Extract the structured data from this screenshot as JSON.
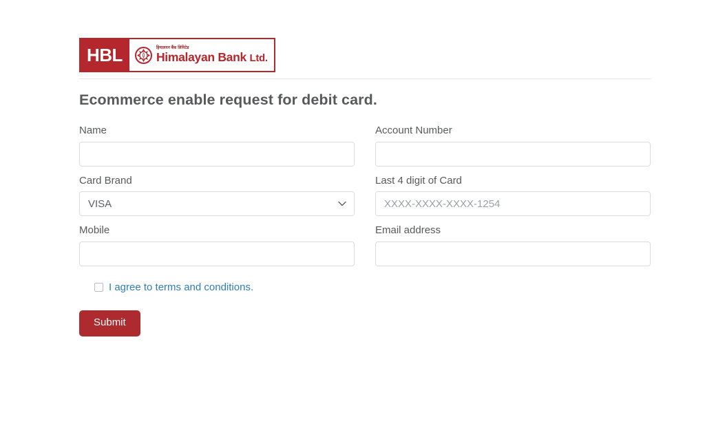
{
  "brand": {
    "mark_text": "HBL",
    "native_name": "हिमालयन बैंक लिमिटेड",
    "name": "Himalayan Bank",
    "suffix": "Ltd.",
    "primary_color": "#b3272d",
    "logo_icon": "himalayan-bank-emblem-icon"
  },
  "heading": {
    "title": "Ecommerce enable request for debit card."
  },
  "form": {
    "name": {
      "label": "Name",
      "value": "",
      "placeholder": ""
    },
    "account_number": {
      "label": "Account Number",
      "value": "",
      "placeholder": ""
    },
    "card_brand": {
      "label": "Card Brand",
      "selected": "VISA",
      "options": [
        "VISA"
      ],
      "chevron_icon": "chevron-down-icon"
    },
    "last_four": {
      "label": "Last 4 digit of Card",
      "value": "",
      "placeholder": "XXXX-XXXX-XXXX-1254"
    },
    "mobile": {
      "label": "Mobile",
      "value": "",
      "placeholder": ""
    },
    "email": {
      "label": "Email address",
      "value": "",
      "placeholder": ""
    },
    "terms": {
      "label": "I agree to terms and conditions.",
      "checked": false,
      "link_color": "#2f7db5"
    },
    "submit": {
      "label": "Submit",
      "color": "#ad2a2e"
    }
  }
}
